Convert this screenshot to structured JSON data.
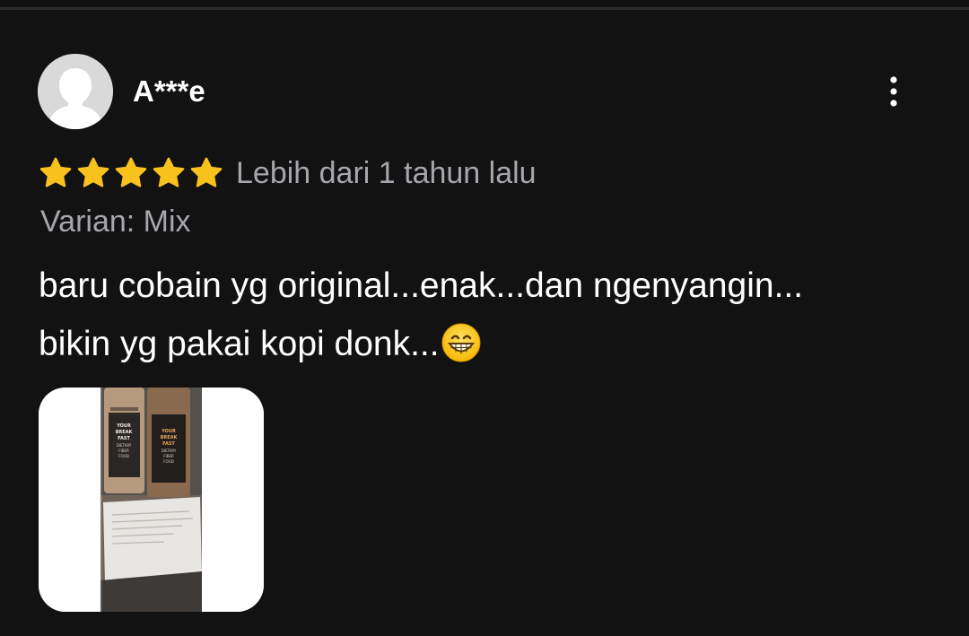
{
  "review": {
    "username": "A***e",
    "rating": 5,
    "rating_max": 5,
    "timestamp": "Lebih dari 1 tahun lalu",
    "variant": "Varian: Mix",
    "text_line1": "baru cobain yg original...enak...dan ngenyangin...",
    "text_line2": "bikin yg pakai kopi donk...",
    "emoji": "grinning-face-with-smiling-eyes",
    "photo": {
      "bottle_left_text": "YOUR BREAK FAST DIETARY FIBER FOOD",
      "bottle_right_text": "YOUR BREAK FAST DIETARY FIBER FOOD"
    }
  },
  "icons": {
    "avatar": "default-user-avatar-icon",
    "more": "more-vertical-icon",
    "star": "star-icon"
  },
  "colors": {
    "background": "#121212",
    "star": "#f8c11c",
    "secondary_text": "#a6a6ad",
    "primary_text": "#ffffff"
  }
}
